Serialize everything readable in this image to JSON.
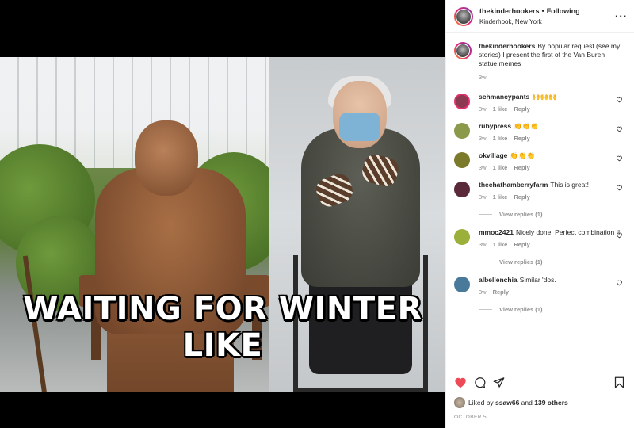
{
  "post": {
    "caption_overlay": "WAITING FOR WINTER LIKE"
  },
  "header": {
    "username": "thekinderhookers",
    "separator": "•",
    "follow_status": "Following",
    "location": "Kinderhook, New York",
    "more_label": "···"
  },
  "caption": {
    "username": "thekinderhookers",
    "text": "By popular request (see my stories) I present the first of the Van Buren statue memes",
    "time": "3w"
  },
  "comments": [
    {
      "username": "schmancypants",
      "text": "🙌🙌🙌",
      "time": "3w",
      "likes": "1 like",
      "reply": "Reply",
      "avatar_color": "#8b3a52"
    },
    {
      "username": "rubypress",
      "text": "👏👏👏",
      "time": "3w",
      "likes": "1 like",
      "reply": "Reply",
      "avatar_color": "#8a9a4a"
    },
    {
      "username": "okvillage",
      "text": "👏👏👏",
      "time": "3w",
      "likes": "1 like",
      "reply": "Reply",
      "avatar_color": "#7a7a2a"
    },
    {
      "username": "thechathamberryfarm",
      "text": "This is great!",
      "time": "3w",
      "likes": "1 like",
      "reply": "Reply",
      "view_replies": "View replies (1)",
      "avatar_color": "#5a2a3a"
    },
    {
      "username": "mmoc2421",
      "text": "Nicely done. Perfect combination !!",
      "time": "3w",
      "likes": "1 like",
      "reply": "Reply",
      "view_replies": "View replies (1)",
      "avatar_color": "#9ab03a"
    },
    {
      "username": "albellenchia",
      "text": "Similar 'dos.",
      "time": "3w",
      "reply": "Reply",
      "view_replies": "View replies (1)",
      "avatar_color": "#4a7a9a"
    }
  ],
  "actions": {
    "liked_by_prefix": "Liked by",
    "liked_by_user": "ssaw66",
    "liked_by_and": "and",
    "liked_by_others": "139 others",
    "date": "OCTOBER 5"
  },
  "colors": {
    "like_red": "#ed4956",
    "meta_gray": "#8e8e8e",
    "text": "#262626"
  }
}
